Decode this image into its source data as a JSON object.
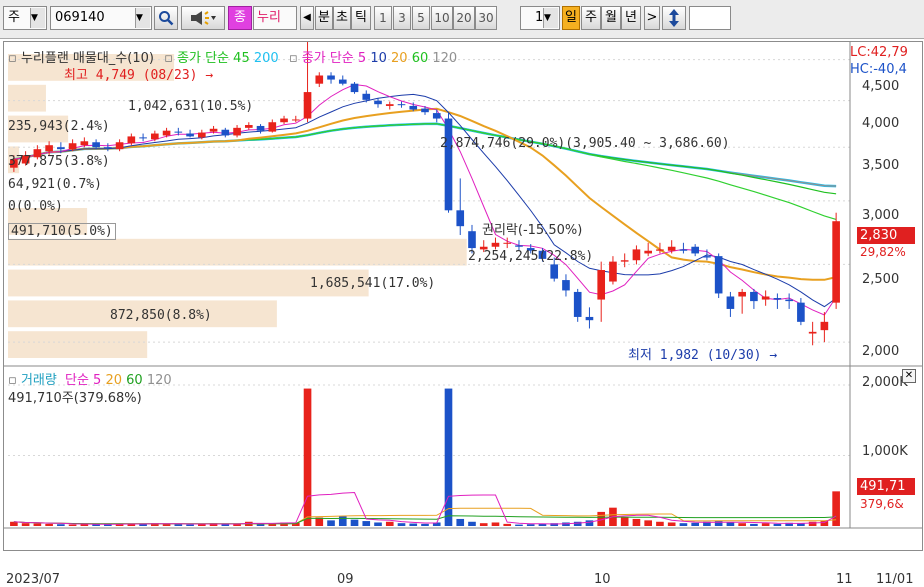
{
  "toolbar": {
    "market_select": "주",
    "code_value": "069140",
    "search_icon": "magnifier-icon",
    "sound_icon": "speaker-icon",
    "badge_label": "종",
    "stock_short_name": "누리",
    "prev_arrow": "◀",
    "periods": [
      "분",
      "초",
      "틱"
    ],
    "intervals": [
      "1",
      "3",
      "5",
      "10",
      "20",
      "30"
    ],
    "count_value": "1",
    "period_tabs": [
      "일",
      "주",
      "월",
      "년"
    ],
    "next_arrow": ">",
    "updown_icon": "up-down-arrow-icon"
  },
  "legend_price": {
    "stock_label": "누리플랜 매물대_수(10)",
    "ma_price_label": "종가 단순",
    "ma_price_periods": [
      "45",
      "200"
    ],
    "ma2_label": "종가 단순",
    "ma2_periods": [
      "5",
      "10",
      "20",
      "60",
      "120"
    ]
  },
  "legend_volume": {
    "volume_label": "거래량",
    "ma_label": "단순",
    "periods": [
      "5",
      "20",
      "60",
      "120"
    ],
    "current_volume": "491,710주(379.68%)"
  },
  "annotations": {
    "high": "최고 4,749 (08/23)",
    "low": "최저 1,982 (10/30)",
    "rights": "권리락(-15.50%)",
    "lc": "LC:42,79",
    "hc": "HC:-40,4"
  },
  "volume_profile_labels": [
    "1,042,631(10.5%)",
    "235,943(2.4%)",
    "377,875(3.8%)",
    "64,921(0.7%)",
    "0(0.0%)",
    "491,710(5.0%)",
    "2,874,746(29.0%)(3,905.40 ~ 3,686.60)",
    "2,254,245(22.8%)",
    "1,685,541(17.0%)",
    "872,850(8.8%)"
  ],
  "price_axis": [
    "4,500",
    "4,000",
    "3,500",
    "3,000",
    "2,500",
    "2,000"
  ],
  "volume_axis": [
    "2,000K",
    "1,000K"
  ],
  "current_price": "2,830",
  "current_change": "29,82%",
  "current_volume_box": "491,71",
  "current_volume_sub": "379,6&",
  "date_axis": [
    "2023/07",
    "09",
    "10",
    "11",
    "11/01"
  ],
  "colors": {
    "up": "#e8221b",
    "down": "#1c52c8",
    "ma5": "#e020c0",
    "ma10": "#1c3caa",
    "ma20": "#e8a020",
    "ma60": "#20c020",
    "ma120": "#909090",
    "ma200": "#20c0f0",
    "profile": "#f3dcc2"
  },
  "chart_data": {
    "type": "candlestick",
    "x": [
      "07-18",
      "07-19",
      "07-20",
      "07-21",
      "07-24",
      "07-25",
      "07-26",
      "07-27",
      "07-28",
      "07-31",
      "08-01",
      "08-02",
      "08-03",
      "08-04",
      "08-07",
      "08-08",
      "08-09",
      "08-10",
      "08-11",
      "08-14",
      "08-16",
      "08-17",
      "08-18",
      "08-21",
      "08-22",
      "08-23",
      "08-24",
      "08-25",
      "08-28",
      "08-29",
      "08-30",
      "08-31",
      "09-01",
      "09-04",
      "09-05",
      "09-06",
      "09-07",
      "09-08",
      "09-11",
      "09-12",
      "09-13",
      "09-14",
      "09-15",
      "09-18",
      "09-19",
      "09-20",
      "09-21",
      "09-22",
      "09-25",
      "09-26",
      "09-27",
      "10-04",
      "10-05",
      "10-06",
      "10-10",
      "10-11",
      "10-12",
      "10-13",
      "10-16",
      "10-17",
      "10-18",
      "10-19",
      "10-20",
      "10-23",
      "10-24",
      "10-25",
      "10-26",
      "10-27",
      "10-30",
      "10-31",
      "11-01"
    ],
    "open": [
      3300,
      3340,
      3400,
      3460,
      3500,
      3480,
      3520,
      3550,
      3500,
      3480,
      3540,
      3600,
      3580,
      3620,
      3660,
      3640,
      3600,
      3660,
      3680,
      3620,
      3700,
      3720,
      3660,
      3760,
      3790,
      3800,
      4200,
      4300,
      4250,
      4200,
      4080,
      4000,
      3940,
      3960,
      3940,
      3910,
      3860,
      3800,
      2920,
      2750,
      2610,
      2630,
      2660,
      2640,
      2620,
      2600,
      2500,
      2390,
      2310,
      2150,
      2260,
      2380,
      2520,
      2530,
      2580,
      2600,
      2600,
      2610,
      2630,
      2560,
      2560,
      2280,
      2280,
      2310,
      2260,
      2270,
      2260,
      2240,
      2050,
      2070,
      2240
    ],
    "close": [
      3380,
      3420,
      3480,
      3520,
      3480,
      3540,
      3560,
      3500,
      3490,
      3550,
      3610,
      3590,
      3640,
      3670,
      3650,
      3610,
      3650,
      3690,
      3620,
      3700,
      3730,
      3670,
      3760,
      3800,
      3790,
      4100,
      4300,
      4250,
      4200,
      4100,
      4010,
      3960,
      3960,
      3950,
      3900,
      3870,
      3800,
      2920,
      2790,
      2620,
      2630,
      2660,
      2660,
      2630,
      2600,
      2540,
      2400,
      2320,
      2150,
      2130,
      2460,
      2520,
      2530,
      2610,
      2600,
      2610,
      2630,
      2600,
      2580,
      2550,
      2300,
      2200,
      2310,
      2250,
      2280,
      2260,
      2250,
      2120,
      2060,
      2120,
      2830
    ],
    "high": [
      3420,
      3460,
      3520,
      3560,
      3550,
      3580,
      3600,
      3580,
      3540,
      3580,
      3640,
      3640,
      3670,
      3700,
      3700,
      3680,
      3680,
      3720,
      3700,
      3730,
      3760,
      3740,
      3790,
      3830,
      3830,
      4749,
      4340,
      4340,
      4300,
      4220,
      4120,
      4030,
      3990,
      3990,
      3980,
      3940,
      3900,
      3860,
      3200,
      2800,
      2680,
      2700,
      2700,
      2680,
      2650,
      2620,
      2550,
      2430,
      2330,
      2210,
      2520,
      2560,
      2580,
      2640,
      2660,
      2660,
      2680,
      2660,
      2650,
      2610,
      2580,
      2310,
      2330,
      2330,
      2320,
      2300,
      2300,
      2270,
      2120,
      2180,
      2900
    ],
    "low": [
      3260,
      3320,
      3380,
      3420,
      3440,
      3460,
      3500,
      3480,
      3460,
      3460,
      3520,
      3560,
      3560,
      3600,
      3620,
      3600,
      3580,
      3640,
      3600,
      3600,
      3680,
      3640,
      3650,
      3740,
      3760,
      3760,
      4160,
      4200,
      4180,
      4080,
      3980,
      3920,
      3900,
      3920,
      3880,
      3840,
      3760,
      2900,
      2720,
      2580,
      2590,
      2610,
      2620,
      2600,
      2580,
      2520,
      2380,
      2280,
      2120,
      2080,
      2120,
      2360,
      2480,
      2500,
      2560,
      2580,
      2580,
      2580,
      2560,
      2530,
      2270,
      2150,
      2170,
      2200,
      2220,
      2200,
      2200,
      2100,
      1982,
      2000,
      2200
    ],
    "volume_k": [
      60,
      40,
      35,
      30,
      25,
      20,
      30,
      25,
      22,
      28,
      35,
      30,
      40,
      30,
      25,
      20,
      30,
      40,
      25,
      30,
      60,
      30,
      40,
      50,
      45,
      1950,
      120,
      80,
      140,
      90,
      70,
      50,
      60,
      40,
      35,
      30,
      50,
      1950,
      100,
      60,
      40,
      50,
      30,
      20,
      25,
      30,
      40,
      50,
      60,
      80,
      200,
      260,
      120,
      100,
      80,
      60,
      50,
      40,
      45,
      60,
      70,
      50,
      40,
      30,
      40,
      30,
      45,
      40,
      60,
      70,
      491.71
    ],
    "price_ylim": [
      1900,
      4600
    ],
    "volume_ylim": [
      0,
      2100
    ],
    "volume_profile": [
      {
        "value": "1,042,631",
        "pct": 10.5
      },
      {
        "value": "235,943",
        "pct": 2.4
      },
      {
        "value": "377,875",
        "pct": 3.8
      },
      {
        "value": "64,921",
        "pct": 0.7
      },
      {
        "value": "0",
        "pct": 0.0
      },
      {
        "value": "491,710",
        "pct": 5.0
      },
      {
        "value": "2,874,746",
        "pct": 29.0
      },
      {
        "value": "2,254,245",
        "pct": 22.8
      },
      {
        "value": "1,685,541",
        "pct": 17.0
      },
      {
        "value": "872,850",
        "pct": 8.8
      }
    ]
  }
}
